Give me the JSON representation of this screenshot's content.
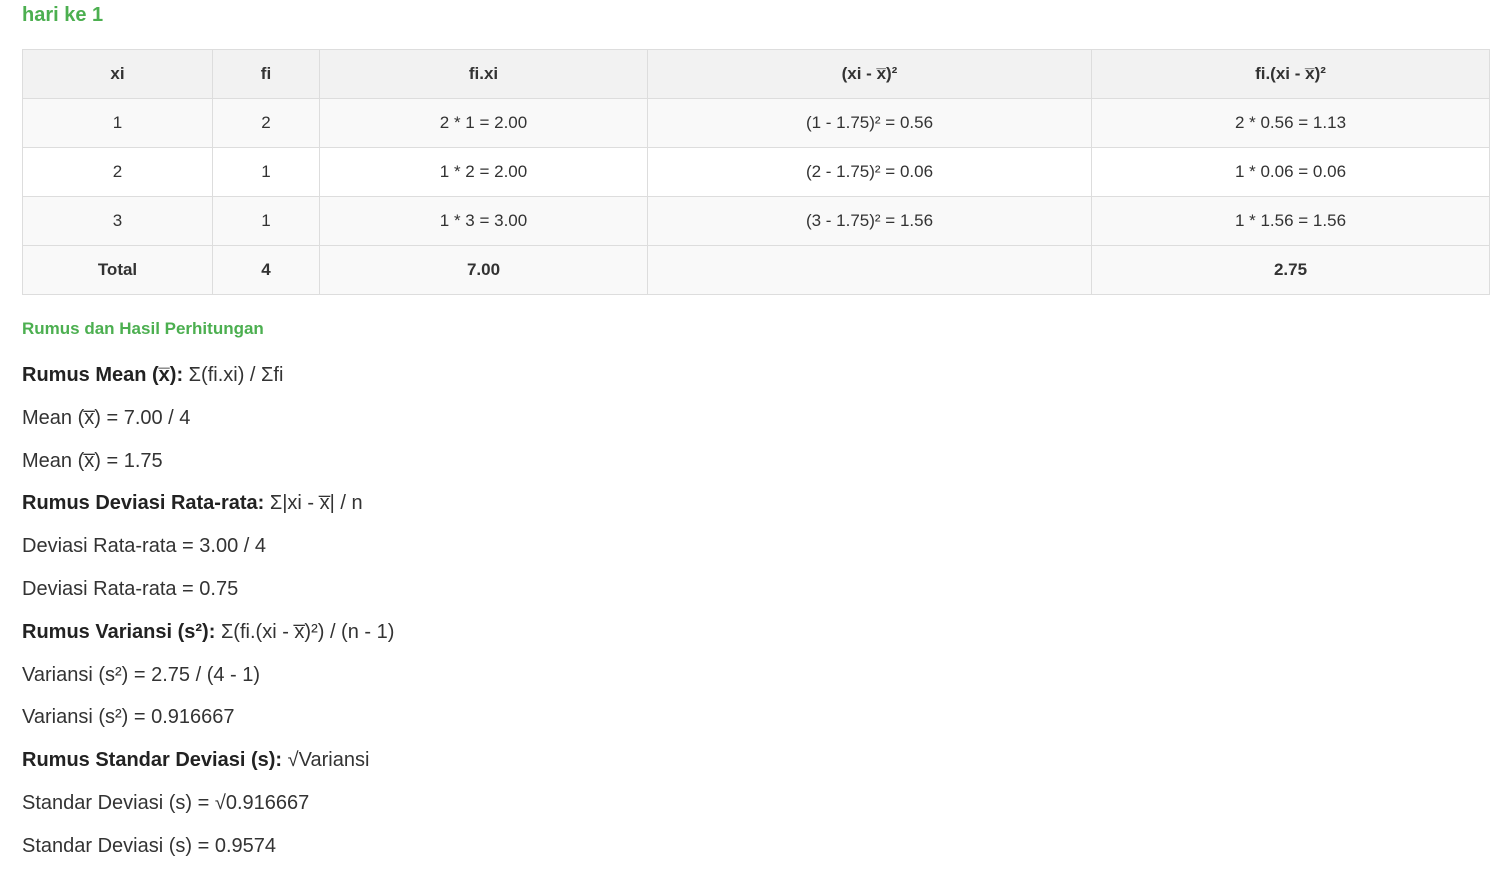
{
  "day_title": "hari ke 1",
  "table": {
    "headers": [
      "xi",
      "fi",
      "fi.xi",
      "(xi - x̅)²",
      "fi.(xi - x̅)²"
    ],
    "rows": [
      [
        "1",
        "2",
        "2 * 1 = 2.00",
        "(1 - 1.75)² = 0.56",
        "2 * 0.56 = 1.13"
      ],
      [
        "2",
        "1",
        "1 * 2 = 2.00",
        "(2 - 1.75)² = 0.06",
        "1 * 0.06 = 0.06"
      ],
      [
        "3",
        "1",
        "1 * 3 = 3.00",
        "(3 - 1.75)² = 1.56",
        "1 * 1.56 = 1.56"
      ]
    ],
    "total": [
      "Total",
      "4",
      "7.00",
      "",
      "2.75"
    ]
  },
  "results": {
    "title": "Rumus dan Hasil Perhitungan",
    "mean_formula_label": "Rumus Mean (x̅):",
    "mean_formula": " Σ(fi.xi) / Σfi",
    "mean_calc": "Mean (x̅) = 7.00 / 4",
    "mean_result": "Mean (x̅) = 1.75",
    "mad_formula_label": "Rumus Deviasi Rata-rata:",
    "mad_formula": " Σ|xi - x̅| / n",
    "mad_calc": "Deviasi Rata-rata = 3.00 / 4",
    "mad_result": "Deviasi Rata-rata = 0.75",
    "var_formula_label": "Rumus Variansi (s²):",
    "var_formula": " Σ(fi.(xi - x̅)²) / (n - 1)",
    "var_calc": "Variansi (s²) = 2.75 / (4 - 1)",
    "var_result": "Variansi (s²) = 0.916667",
    "sd_formula_label": "Rumus Standar Deviasi (s):",
    "sd_formula": " √Variansi",
    "sd_calc": "Standar Deviasi (s) = √0.916667",
    "sd_result": "Standar Deviasi (s) = 0.9574"
  },
  "colors": {
    "accent_green": "#4caf50",
    "header_bg": "#f2f2f2",
    "border": "#dddddd"
  }
}
